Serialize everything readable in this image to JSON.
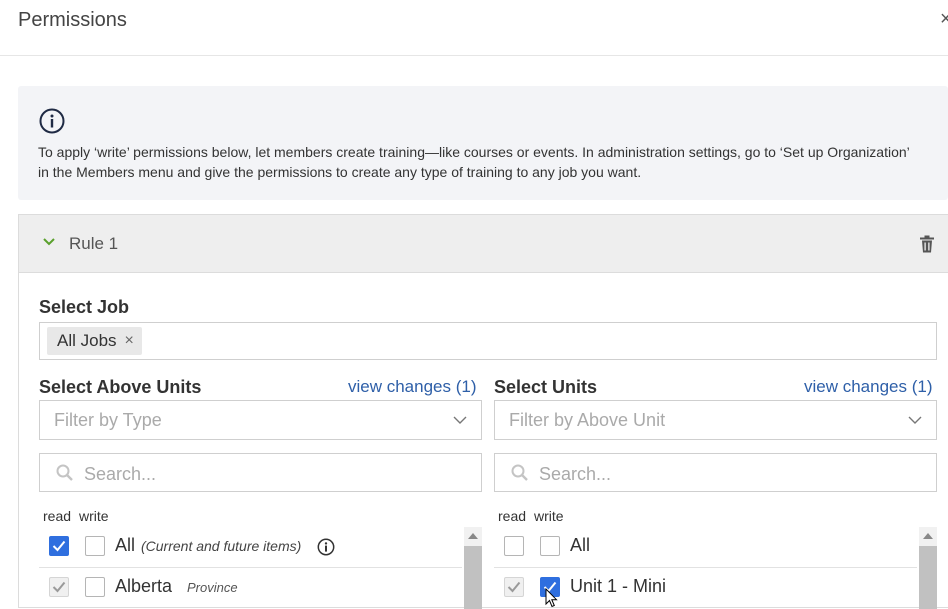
{
  "dialog": {
    "title": "Permissions",
    "close_glyph": "×"
  },
  "info": {
    "icon": "info-circle-icon",
    "text": "To apply ‘write’ permissions below, let members create training—like courses or events. In administration settings, go to ‘Set up Organization’ in the Members menu and give the permissions to create any type of training to any job you want."
  },
  "rule": {
    "title": "Rule 1",
    "select_job": {
      "label": "Select Job",
      "chips": [
        {
          "label": "All Jobs",
          "remove_glyph": "×"
        }
      ]
    },
    "above_units": {
      "label": "Select Above Units",
      "view_changes": "view changes (1)",
      "filter_placeholder": "Filter by Type",
      "search_placeholder": "Search...",
      "col_read": "read",
      "col_write": "write",
      "rows": [
        {
          "label": "All",
          "note": "(Current and future items)",
          "read": "checked",
          "write": "unchecked"
        },
        {
          "label": "Alberta",
          "tag": "Province",
          "read": "disabled-checked",
          "write": "unchecked"
        }
      ]
    },
    "units": {
      "label": "Select Units",
      "view_changes": "view changes (1)",
      "filter_placeholder": "Filter by Above Unit",
      "search_placeholder": "Search...",
      "col_read": "read",
      "col_write": "write",
      "rows": [
        {
          "label": "All",
          "read": "unchecked",
          "write": "unchecked"
        },
        {
          "label": "Unit 1 - Mini",
          "read": "disabled-checked",
          "write": "checked"
        }
      ]
    }
  },
  "colors": {
    "accent": "#2f6fdf",
    "link": "#2e5fa8",
    "chevron": "#5aa02c"
  }
}
